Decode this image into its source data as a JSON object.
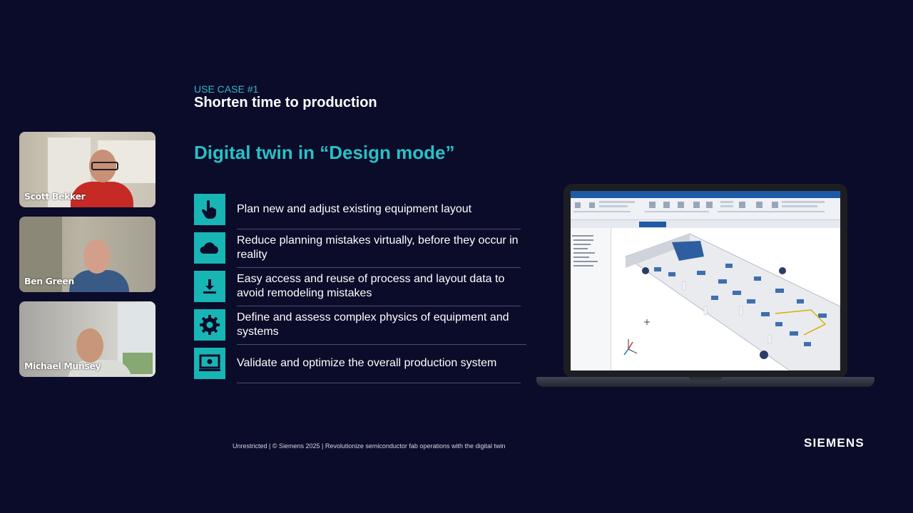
{
  "participants": [
    {
      "name": "Scott Bekker"
    },
    {
      "name": "Ben Green"
    },
    {
      "name": "Michael Munsey"
    }
  ],
  "slide": {
    "eyebrow": "USE CASE #1",
    "subtitle": "Shorten time to production",
    "headline": "Digital twin in “Design mode”",
    "features": [
      {
        "icon": "hand-pointer-icon",
        "text": "Plan new and adjust existing equipment layout"
      },
      {
        "icon": "cloud-icon",
        "text": "Reduce planning mistakes virtually, before they occur in reality"
      },
      {
        "icon": "download-icon",
        "text": "Easy access and reuse of process and layout data to avoid remodeling mistakes"
      },
      {
        "icon": "gear-icon",
        "text": "Define and assess complex physics of equipment and systems"
      },
      {
        "icon": "monitor-gear-icon",
        "text": "Validate and optimize the overall production system"
      }
    ],
    "footer": "Unrestricted | © Siemens 2025 | Revolutionize semiconductor fab operations with the digital twin",
    "brand": "SIEMENS"
  },
  "colors": {
    "background": "#0b0b2a",
    "accent": "#18b5b5",
    "headline": "#27c1c7",
    "eyebrow": "#37b7c3"
  }
}
